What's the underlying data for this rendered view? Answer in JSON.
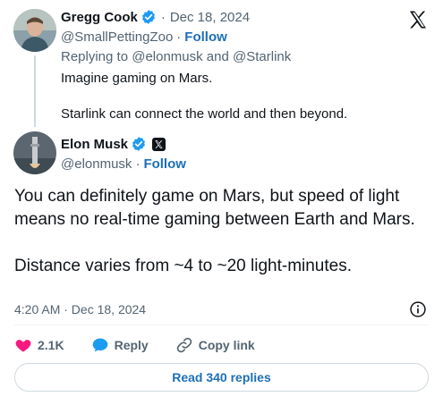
{
  "reply_tweet": {
    "author_name": "Gregg Cook",
    "separator": "·",
    "date": "Dec 18, 2024",
    "handle": "@SmallPettingZoo",
    "follow_label": "Follow",
    "replying_to": "Replying to @elonmusk and @Starlink",
    "text_line_1": "Imagine gaming on Mars.",
    "text_line_2": "Starlink can connect the world and then beyond."
  },
  "main_tweet": {
    "author_name": "Elon Musk",
    "handle": "@elonmusk",
    "separator": "·",
    "follow_label": "Follow",
    "paragraph_1": "You can definitely game on Mars, but speed of light means no real-time gaming between Earth and Mars.",
    "paragraph_2": "Distance varies from ~4 to ~20 light-minutes.",
    "timestamp": "4:20 AM · Dec 18, 2024"
  },
  "actions": {
    "like_count": "2.1K",
    "reply_label": "Reply",
    "copy_link_label": "Copy link"
  },
  "read_replies_label": "Read 340 replies",
  "icons": {
    "platform": "x-logo-icon",
    "verified": "verified-badge-icon",
    "info": "info-icon",
    "like": "heart-icon",
    "reply": "speech-bubble-icon",
    "copy": "link-icon"
  },
  "colors": {
    "text": "#0f1419",
    "muted": "#536471",
    "link": "#1d6fb8",
    "verified": "#1d9bf0",
    "like": "#f91880"
  }
}
